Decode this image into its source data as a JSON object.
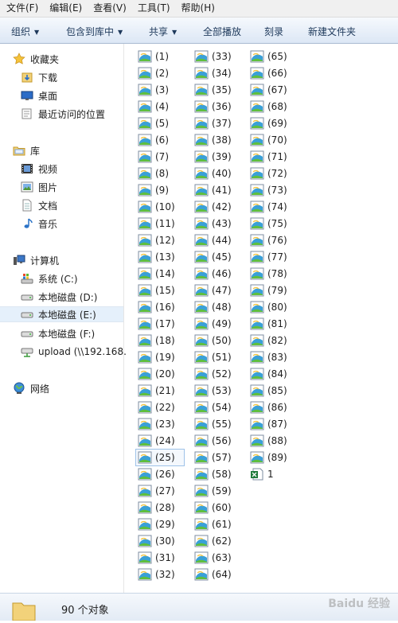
{
  "menu": [
    "文件(F)",
    "编辑(E)",
    "查看(V)",
    "工具(T)",
    "帮助(H)"
  ],
  "toolbar": {
    "organize": "组织",
    "include_library": "包含到库中",
    "share": "共享",
    "play_all": "全部播放",
    "burn": "刻录",
    "new_folder": "新建文件夹"
  },
  "nav": {
    "favorites": "收藏夹",
    "downloads": "下载",
    "desktop": "桌面",
    "recent": "最近访问的位置",
    "libraries": "库",
    "videos": "视频",
    "pictures": "图片",
    "documents": "文档",
    "music": "音乐",
    "computer": "计算机",
    "drive_c": "系统 (C:)",
    "drive_d": "本地磁盘 (D:)",
    "drive_e": "本地磁盘 (E:)",
    "drive_f": "本地磁盘 (F:)",
    "upload": "upload (\\\\192.168.",
    "network": "网络"
  },
  "files": [
    "(1)",
    "(2)",
    "(3)",
    "(4)",
    "(5)",
    "(6)",
    "(7)",
    "(8)",
    "(9)",
    "(10)",
    "(11)",
    "(12)",
    "(13)",
    "(14)",
    "(15)",
    "(16)",
    "(17)",
    "(18)",
    "(19)",
    "(20)",
    "(21)",
    "(22)",
    "(23)",
    "(24)",
    "(25)",
    "(26)",
    "(27)",
    "(28)",
    "(29)",
    "(30)",
    "(31)",
    "(32)",
    "(33)",
    "(34)",
    "(35)",
    "(36)",
    "(37)",
    "(38)",
    "(39)",
    "(40)",
    "(41)",
    "(42)",
    "(43)",
    "(44)",
    "(45)",
    "(46)",
    "(47)",
    "(48)",
    "(49)",
    "(50)",
    "(51)",
    "(52)",
    "(53)",
    "(54)",
    "(55)",
    "(56)",
    "(57)",
    "(58)",
    "(59)",
    "(60)",
    "(61)",
    "(62)",
    "(63)",
    "(64)",
    "(65)",
    "(66)",
    "(67)",
    "(68)",
    "(69)",
    "(70)",
    "(71)",
    "(72)",
    "(73)",
    "(74)",
    "(75)",
    "(76)",
    "(77)",
    "(78)",
    "(79)",
    "(80)",
    "(81)",
    "(82)",
    "(83)",
    "(84)",
    "(85)",
    "(86)",
    "(87)",
    "(88)",
    "(89)"
  ],
  "excel_file": "1",
  "highlighted_file": "(25)",
  "status": {
    "count": "90 个对象"
  },
  "watermark": "Baidu 经验",
  "colors": {
    "toolbar_text": "#1e395b",
    "selected_bg": "#e5f0fb",
    "accent": "#3c7fc4"
  }
}
